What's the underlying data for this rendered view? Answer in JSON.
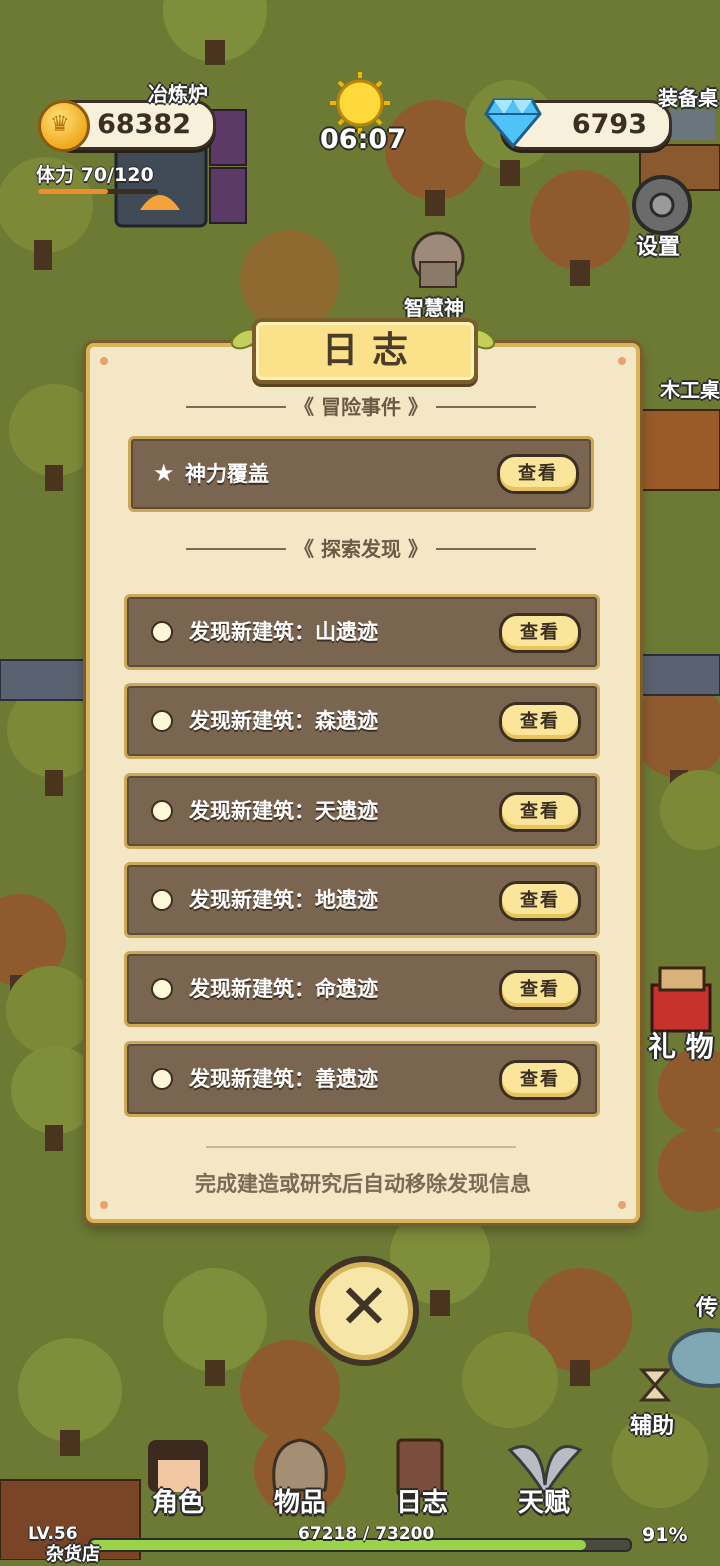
{
  "hud": {
    "gold": "68382",
    "gems": "6793",
    "time": "06:07",
    "stamina_label": "体力",
    "stamina_value": "70/120",
    "stamina_fraction": 0.583
  },
  "map_labels": {
    "smelter": "冶炼炉",
    "equipment": "装备桌",
    "settings": "设置",
    "wisdom_god": "智慧神",
    "woodwork": "木工桌",
    "gift": "礼 物",
    "assist": "辅助",
    "teleport": "传",
    "shop": "杂货店"
  },
  "dialog": {
    "title": "日志",
    "adventure_section": "《 冒险事件 》",
    "adventure_events": [
      {
        "label": "神力覆盖",
        "button": "查看"
      }
    ],
    "explore_section": "《 探索发现 》",
    "discoveries": [
      {
        "label": "发现新建筑：山遗迹",
        "button": "查看"
      },
      {
        "label": "发现新建筑：森遗迹",
        "button": "查看"
      },
      {
        "label": "发现新建筑：天遗迹",
        "button": "查看"
      },
      {
        "label": "发现新建筑：地遗迹",
        "button": "查看"
      },
      {
        "label": "发现新建筑：命遗迹",
        "button": "查看"
      },
      {
        "label": "发现新建筑：善遗迹",
        "button": "查看"
      }
    ],
    "footer_note": "完成建造或研究后自动移除发现信息"
  },
  "bottom_nav": [
    {
      "label": "角色",
      "icon": "character-icon"
    },
    {
      "label": "物品",
      "icon": "backpack-icon"
    },
    {
      "label": "日志",
      "icon": "journal-icon"
    },
    {
      "label": "天赋",
      "icon": "wings-sword-icon"
    }
  ],
  "level": {
    "label": "LV.56",
    "xp": "67218 / 73200",
    "percent": "91%",
    "xp_fraction": 0.918
  },
  "colors": {
    "ground": "#6d7a34",
    "panel": "#f3e7c6",
    "row": "#7a6550",
    "button": "#fbe59a",
    "xp_fill": "#9ad24a"
  }
}
